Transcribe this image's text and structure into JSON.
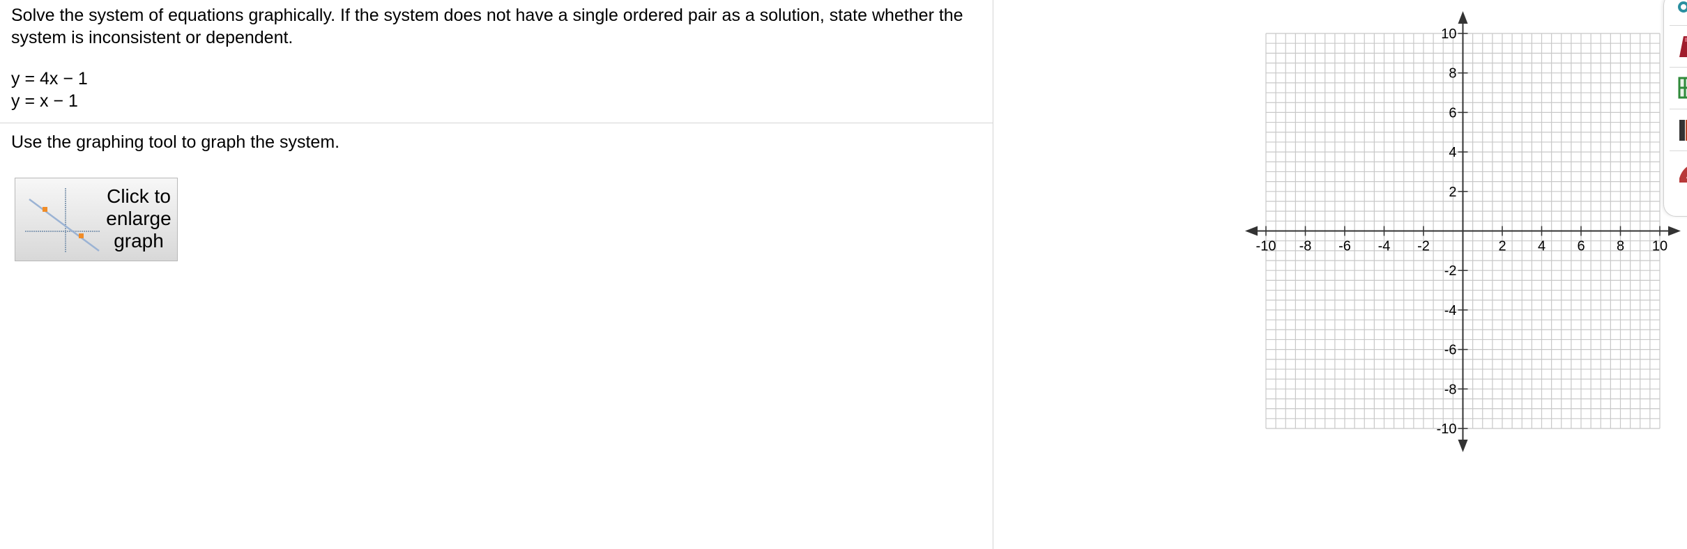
{
  "question": {
    "prompt": "Solve the system of equations graphically. If the system does not have a single ordered pair as a solution, state whether the system is inconsistent or dependent.",
    "equations": [
      "y = 4x − 1",
      "y = x − 1"
    ],
    "instruction": "Use the graphing tool to graph the system."
  },
  "enlarge_button": {
    "label": "Click to\nenlarge\ngraph"
  },
  "graph": {
    "x_min": -10,
    "x_max": 10,
    "y_min": -10,
    "y_max": 10,
    "x_tick_labels": [
      "-10",
      "-8",
      "-6",
      "-4",
      "-2",
      "2",
      "4",
      "6",
      "8",
      "10"
    ],
    "y_tick_labels": [
      "10",
      "8",
      "6",
      "4",
      "2",
      "-2",
      "-4",
      "-6",
      "-8",
      "-10"
    ],
    "grid_color": "#c8c8c8",
    "axis_color": "#333333"
  },
  "toolbar": {
    "icons": [
      "teal-tool-icon",
      "red-book-icon",
      "green-grid-icon",
      "books-icon",
      "red-tool-icon"
    ]
  }
}
